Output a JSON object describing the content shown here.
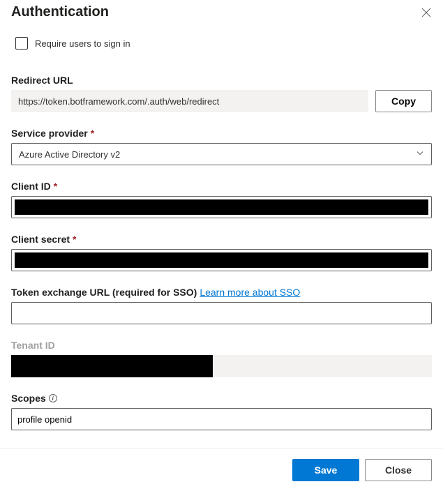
{
  "header": {
    "title": "Authentication"
  },
  "require_signin": {
    "label": "Require users to sign in",
    "checked": false
  },
  "redirect_url": {
    "label": "Redirect URL",
    "value": "https://token.botframework.com/.auth/web/redirect",
    "copy_label": "Copy"
  },
  "service_provider": {
    "label": "Service provider",
    "value": "Azure Active Directory v2"
  },
  "client_id": {
    "label": "Client ID",
    "value": ""
  },
  "client_secret": {
    "label": "Client secret",
    "value": ""
  },
  "token_exchange": {
    "label": "Token exchange URL (required for SSO)",
    "link_text": "Learn more about SSO",
    "value": ""
  },
  "tenant_id": {
    "label": "Tenant ID",
    "value": ""
  },
  "scopes": {
    "label": "Scopes",
    "value": "profile openid"
  },
  "footer": {
    "save": "Save",
    "close": "Close"
  }
}
